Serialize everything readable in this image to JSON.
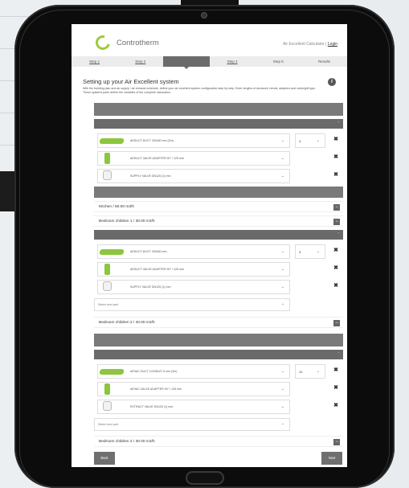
{
  "header": {
    "brand": "Controtherm",
    "calc_link": "Air Excellent Calculator",
    "separator": "|",
    "login": "Login"
  },
  "steps": [
    "Step 1",
    "Step 2",
    "",
    "Step 4",
    "Step 5",
    "Results"
  ],
  "title": "Setting up your Air Excellent system",
  "description": "With the building plan and air supply / air exhaust schedule, define your air excellent system configuration step by step. Enter lengths of ductwork, bends, adapters and valve/grill type. These systems parts define the variables of the complete calculation.",
  "group1": {
    "parts": [
      {
        "name": "AEDUCT-DUCT 150x50 mm (2m)",
        "icon": "duct-image",
        "qty": "4"
      },
      {
        "name": "AEDUCT VALVE ADAPTER 90° / 125 mm",
        "icon": "adapter-image"
      },
      {
        "name": "SUPPLY VALVE DN125 (1) mm",
        "icon": "valve-image"
      }
    ]
  },
  "rooms_a": [
    "Kitchen / 50.00 m3/h",
    "Bedroom children 1 / 30.00 m3/h"
  ],
  "group2": {
    "parts": [
      {
        "name": "AEDUCT-DUCT 150x50 mm",
        "icon": "duct-image",
        "qty": "3"
      },
      {
        "name": "AEDUCT VALVE ADAPTER 90° / 125 mm",
        "icon": "adapter-image"
      },
      {
        "name": "SUPPLY VALVE DN125 (1) mm",
        "icon": "valve-image"
      }
    ],
    "select_next": "Select next part"
  },
  "room_b": "Bedroom children 3 / 40.00 m3/h",
  "group3": {
    "parts": [
      {
        "name": "AEVAC DUCT CONDUIT 5 mm (2m)",
        "icon": "duct-image",
        "qty": "12"
      },
      {
        "name": "AEVAC VALVE ADAPTER 90° / 125 mm",
        "icon": "adapter-image"
      },
      {
        "name": "EXTRACT VALVE DN125 (1) mm",
        "icon": "valve-image"
      }
    ],
    "select_next": "Select next part"
  },
  "room_c": "Bedroom children 2 / 30.00 m3/h",
  "buttons": {
    "back": "Back",
    "next": "Next"
  },
  "colors": {
    "accent": "#8cc63f",
    "bar": "#7a7a7a"
  }
}
